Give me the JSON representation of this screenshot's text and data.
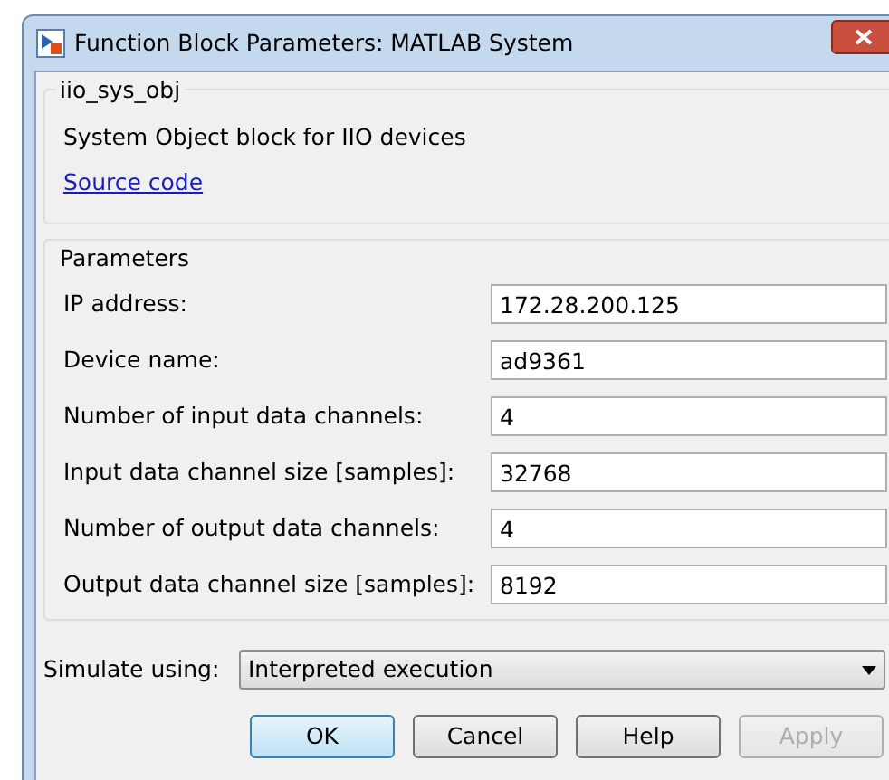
{
  "window": {
    "title": "Function Block Parameters: MATLAB System"
  },
  "block": {
    "name": "iio_sys_obj",
    "description": "System Object block for IIO devices",
    "link": "Source code"
  },
  "parameters": {
    "title": "Parameters",
    "fields": [
      {
        "label": "IP address:",
        "value": "172.28.200.125"
      },
      {
        "label": "Device name:",
        "value": "ad9361"
      },
      {
        "label": "Number of input data channels:",
        "value": "4"
      },
      {
        "label": "Input data channel size [samples]:",
        "value": "32768"
      },
      {
        "label": "Number of output data channels:",
        "value": "4"
      },
      {
        "label": "Output data channel size [samples]:",
        "value": "8192"
      }
    ]
  },
  "simulate": {
    "label": "Simulate using:",
    "value": "Interpreted execution"
  },
  "buttons": [
    {
      "label": "OK",
      "default": true,
      "disabled": false
    },
    {
      "label": "Cancel",
      "default": false,
      "disabled": false
    },
    {
      "label": "Help",
      "default": false,
      "disabled": false
    },
    {
      "label": "Apply",
      "default": false,
      "disabled": true
    }
  ]
}
